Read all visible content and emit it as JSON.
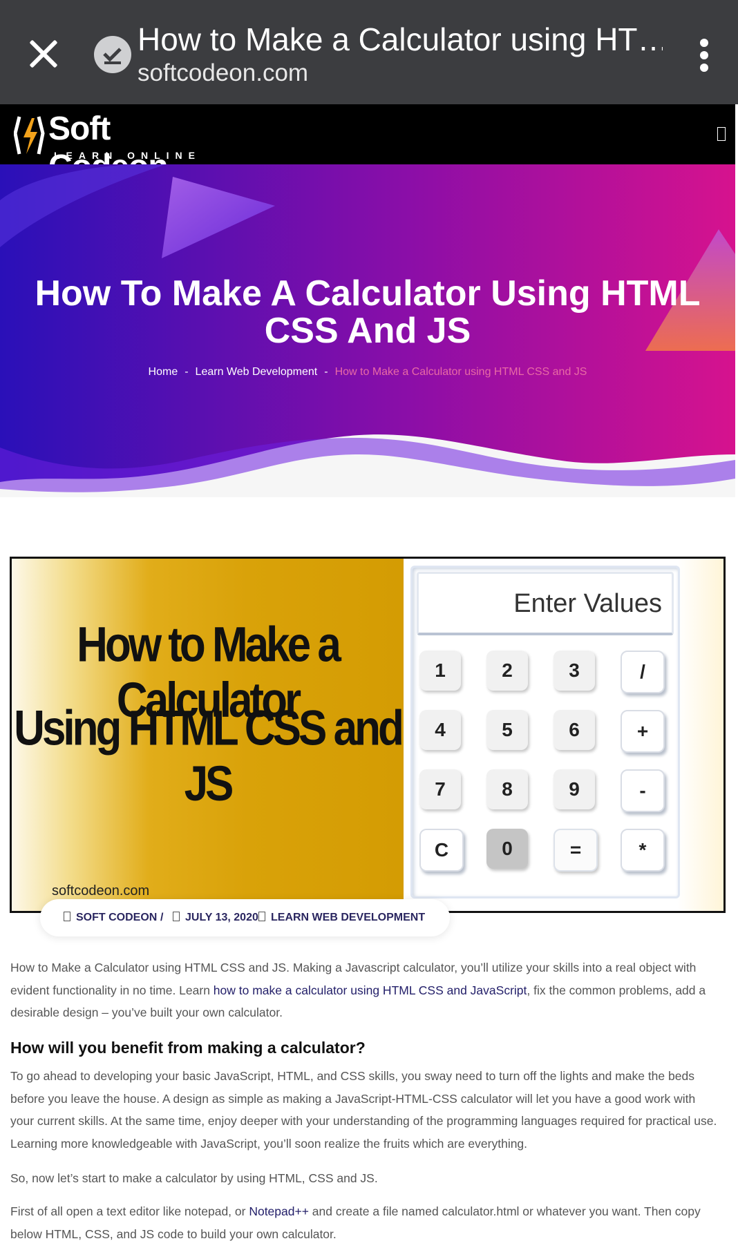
{
  "browser": {
    "tab_title": "How to Make a Calculator using HT…",
    "url": "softcodeon.com"
  },
  "site": {
    "logo_text": "Soft Codeon",
    "logo_tagline": "LEARN ONLINE"
  },
  "hero": {
    "title": "How To Make A Calculator Using HTML CSS And JS",
    "breadcrumb": [
      "Home",
      "Learn Web Development",
      "How to Make a Calculator using HTML CSS and JS"
    ],
    "separator": "-"
  },
  "featured_image": {
    "line1": "How to Make a Calculator",
    "line2": "Using HTML CSS and JS",
    "site": "softcodeon.com",
    "screen_text": "Enter Values",
    "keys": [
      "1",
      "2",
      "3",
      "/",
      "4",
      "5",
      "6",
      "+",
      "7",
      "8",
      "9",
      "-",
      "C",
      "0",
      "=",
      "*"
    ]
  },
  "meta": {
    "author": "SOFT CODEON",
    "divider": "/",
    "date": "JULY 13, 2020",
    "category": "LEARN WEB DEVELOPMENT"
  },
  "article": {
    "p1_a": "How to Make a Calculator using HTML CSS and JS. Making a Javascript calculator, you’ll utilize your skills into a real object with evident functionality in no time. Learn ",
    "p1_link": "how to make a calculator using HTML CSS and JavaScript",
    "p1_b": ", fix the common problems, add a desirable design – you’ve built your own calculator.",
    "heading": "How will you benefit from making a calculator?",
    "p2": "To go ahead to developing your basic JavaScript, HTML, and CSS skills, you sway need to turn off the lights and make the beds before you leave the house. A design as simple as making a JavaScript-HTML-CSS calculator will let you have a good work with your current skills. At the same time, enjoy deeper with your understanding of the programming languages required for practical use. Learning more knowledgeable with JavaScript, you’ll soon realize the fruits which are everything.",
    "p3": "So, now let’s start to make a calculator by using HTML, CSS and JS.",
    "p4_a": "First of all open a text editor like notepad, or ",
    "p4_link": "Notepad++",
    "p4_b": " and create a file named calculator.html or whatever you want. Then copy below HTML, CSS, and JS code to build your own calculator."
  },
  "colors": {
    "browser_bar": "#3c3d40",
    "hero_start": "#2a10b8",
    "hero_end": "#d6128e",
    "link": "#24206a",
    "breadcrumb_current": "#e86aa5"
  }
}
